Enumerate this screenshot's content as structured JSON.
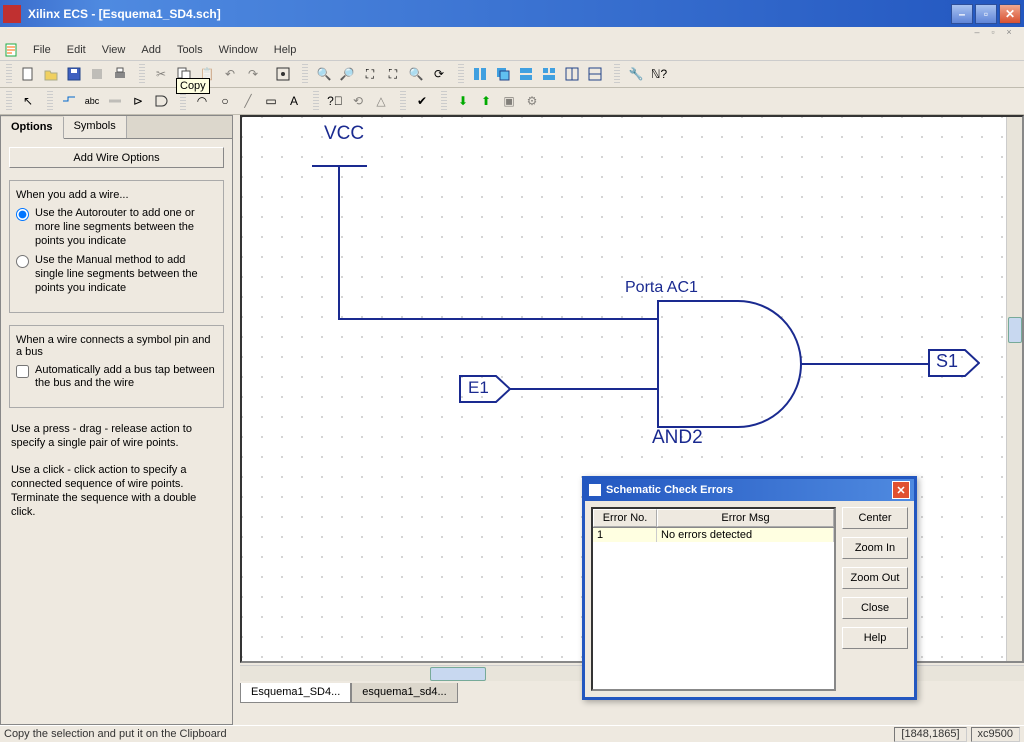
{
  "window": {
    "title": "Xilinx ECS - [Esquema1_SD4.sch]"
  },
  "menu": [
    "File",
    "Edit",
    "View",
    "Add",
    "Tools",
    "Window",
    "Help"
  ],
  "tooltip": "Copy",
  "sidebar": {
    "tabs": [
      "Options",
      "Symbols"
    ],
    "add_wire_btn": "Add Wire Options",
    "group1_intro": "When you add a wire...",
    "opt_auto": "Use the Autorouter to add one or more line segments between the points you indicate",
    "opt_manual": "Use the Manual method to add single line segments between the points you indicate",
    "group2_intro": "When a wire connects a symbol pin and a bus",
    "opt_bustap": "Automatically add a bus tap between the bus and the wire",
    "help1": "Use a press - drag - release action to specify a single pair of wire points.",
    "help2": "Use a click - click action to specify a connected sequence of wire points. Terminate the sequence with a double click."
  },
  "schematic": {
    "vcc": "VCC",
    "porta": "Porta AC1",
    "e1": "E1",
    "s1": "S1",
    "and2": "AND2"
  },
  "dialog": {
    "title": "Schematic Check Errors",
    "col1": "Error No.",
    "col2": "Error Msg",
    "row_no": "1",
    "row_msg": "No errors detected",
    "btns": [
      "Center",
      "Zoom In",
      "Zoom Out",
      "Close",
      "Help"
    ]
  },
  "doctabs": [
    "Esquema1_SD4...",
    "esquema1_sd4..."
  ],
  "status": {
    "msg": "Copy the selection and put it on the Clipboard",
    "coords": "[1848,1865]",
    "device": "xc9500"
  }
}
